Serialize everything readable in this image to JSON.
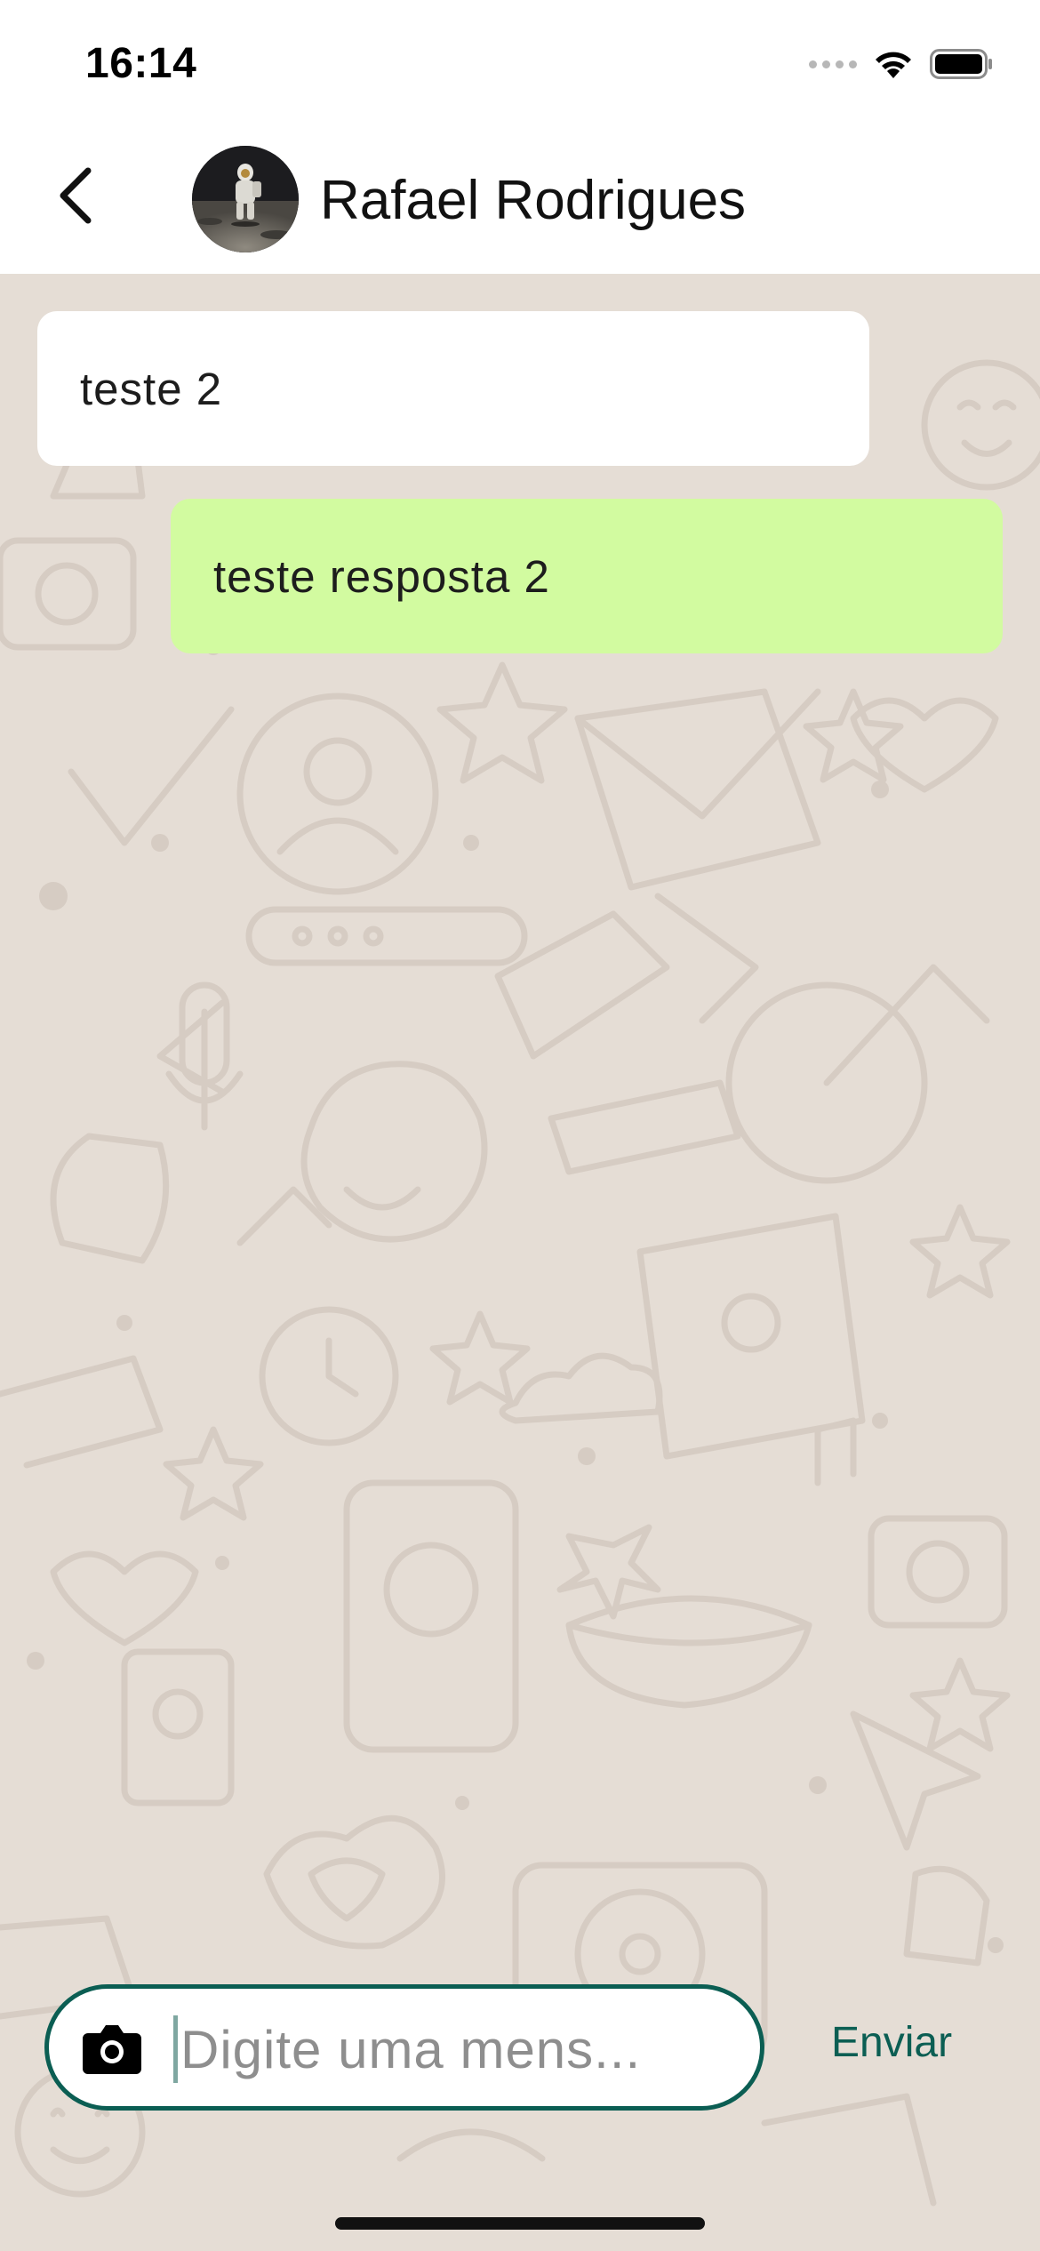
{
  "status_bar": {
    "time": "16:14"
  },
  "header": {
    "contact_name": "Rafael Rodrigues",
    "back_icon": "chevron-left-icon",
    "avatar_alt": "Rafael Rodrigues"
  },
  "messages": [
    {
      "text": "teste 2",
      "direction": "incoming",
      "color": "#ffffff"
    },
    {
      "text": "teste resposta 2",
      "direction": "outgoing",
      "color": "#d2fba0"
    }
  ],
  "composer": {
    "placeholder": "Digite uma mens...",
    "value": "",
    "camera_icon": "camera-icon",
    "send_label": "Enviar"
  },
  "colors": {
    "accent": "#0b5e53",
    "chat_background": "#e5ddd5",
    "outgoing_bubble": "#d2fba0",
    "incoming_bubble": "#ffffff"
  }
}
